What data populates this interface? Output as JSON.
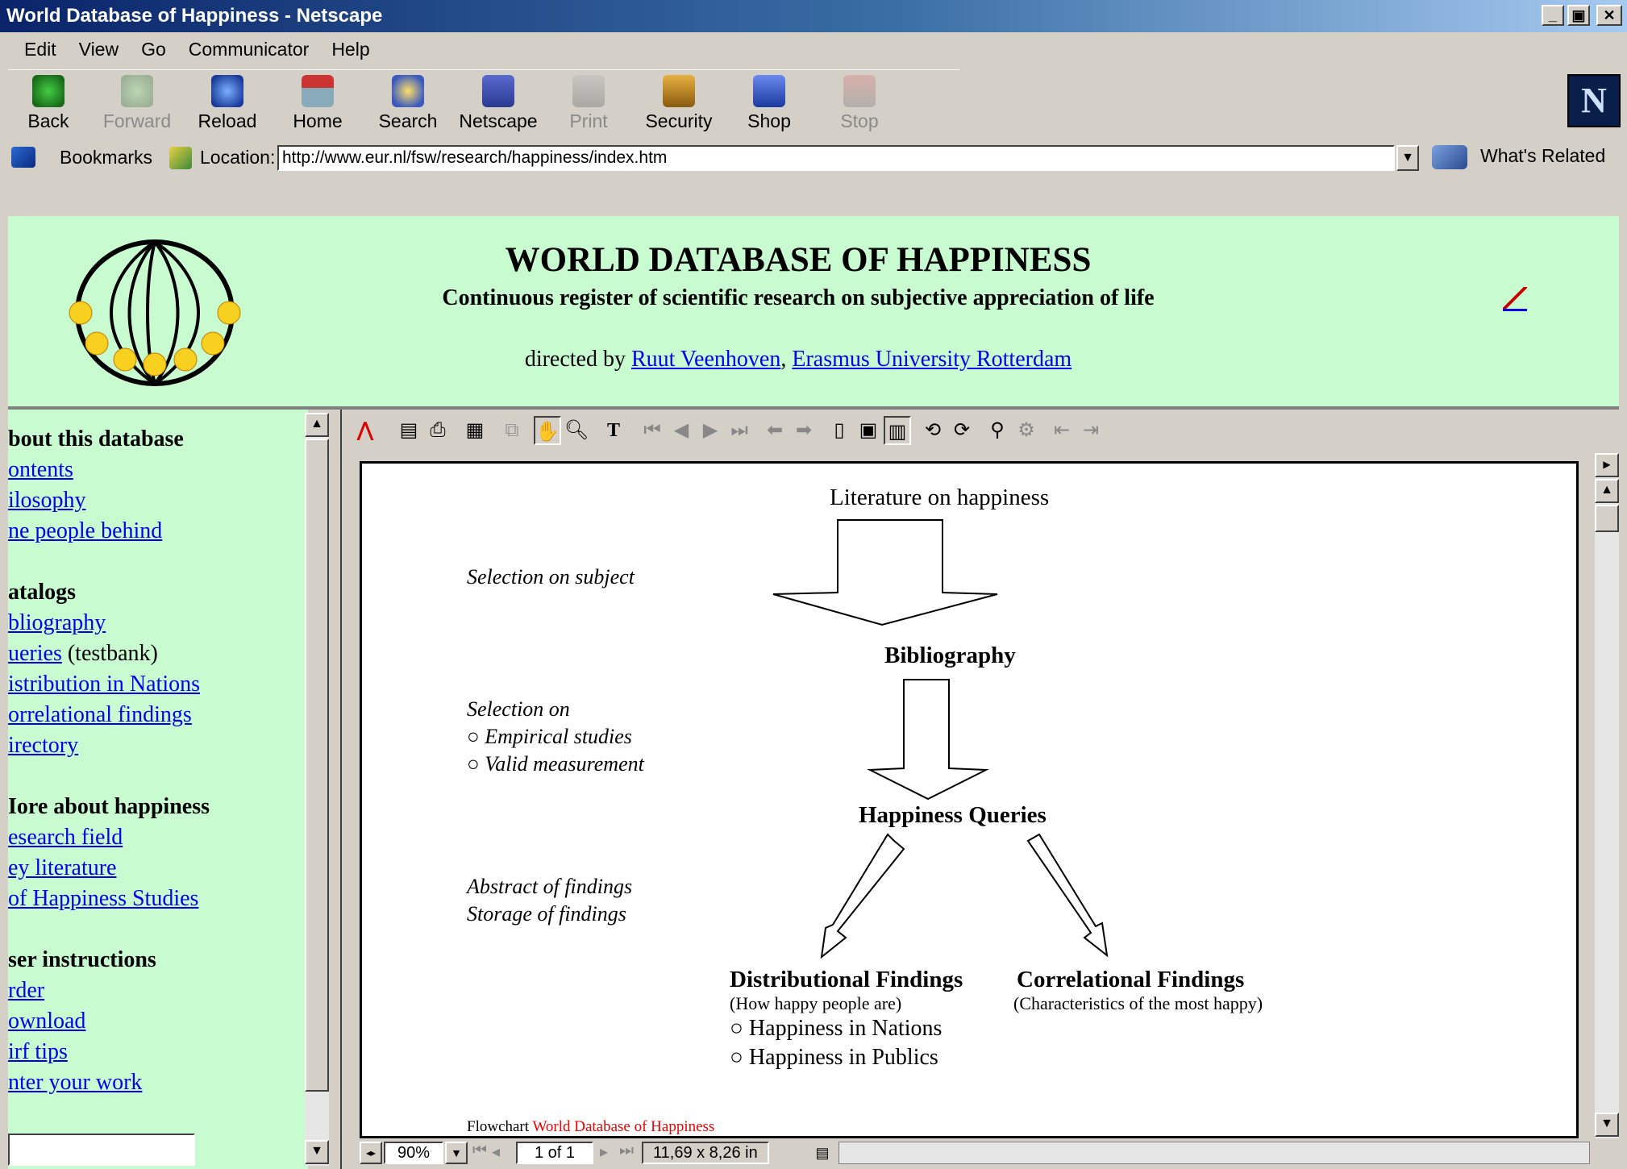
{
  "window": {
    "title": "World Database of Happiness - Netscape"
  },
  "menu": [
    "Edit",
    "View",
    "Go",
    "Communicator",
    "Help"
  ],
  "toolbar": {
    "buttons": [
      {
        "label": "Back",
        "icon": "back-arrow-icon",
        "enabled": true
      },
      {
        "label": "Forward",
        "icon": "forward-arrow-icon",
        "enabled": false
      },
      {
        "label": "Reload",
        "icon": "reload-icon",
        "enabled": true
      },
      {
        "label": "Home",
        "icon": "home-icon",
        "enabled": true
      },
      {
        "label": "Search",
        "icon": "search-icon",
        "enabled": true
      },
      {
        "label": "Netscape",
        "icon": "my-netscape-icon",
        "enabled": true
      },
      {
        "label": "Print",
        "icon": "print-icon",
        "enabled": false
      },
      {
        "label": "Security",
        "icon": "security-lock-icon",
        "enabled": true
      },
      {
        "label": "Shop",
        "icon": "shop-bag-icon",
        "enabled": true
      },
      {
        "label": "Stop",
        "icon": "stop-icon",
        "enabled": false
      }
    ],
    "logo": "N"
  },
  "location": {
    "bookmarks_label": "Bookmarks",
    "location_label": "Location:",
    "url": "http://www.eur.nl/fsw/research/happiness/index.htm",
    "whats_related": "What's Related"
  },
  "header": {
    "title": "WORLD DATABASE OF HAPPINESS",
    "subtitle": "Continuous register of scientific research on subjective appreciation of life",
    "directed_by": "directed by",
    "link_person": "Ruut Veenhoven",
    "separator": ",",
    "link_university": "Erasmus University Rotterdam"
  },
  "sidebar": {
    "sections": [
      {
        "heading": "bout this database",
        "items": [
          "ontents ",
          "ilosophy",
          "ne people behind"
        ]
      },
      {
        "heading": "atalogs",
        "items": [
          "bliography",
          "ueries",
          "istribution in Nations",
          "orrelational findings ",
          "irectory"
        ],
        "query_suffix": " (testbank)"
      },
      {
        "heading": "Iore about happiness",
        "items": [
          "esearch field",
          "ey literature",
          "of Happiness Studies"
        ]
      },
      {
        "heading": "ser instructions",
        "items": [
          "rder",
          "ownload",
          "irf tips",
          "nter your work"
        ]
      }
    ]
  },
  "pdf": {
    "zoom": "90%",
    "page_indicator": "1 of 1",
    "page_size": "11,69 x 8,26 in",
    "flowchart": {
      "top": "Literature on happiness",
      "sel1": "Selection on subject",
      "node1": "Bibliography",
      "sel2_title": "Selection on",
      "sel2_items": [
        "Empirical studies",
        "Valid measurement"
      ],
      "node2": "Happiness Queries",
      "sel3": [
        "Abstract of findings",
        "Storage of findings"
      ],
      "dist_title": "Distributional Findings",
      "dist_sub": "(How happy people are)",
      "dist_items": [
        "Happiness in Nations",
        "Happiness in Publics"
      ],
      "corr_title": "Correlational Findings",
      "corr_sub": "(Characteristics of the most happy)",
      "caption_prefix": "Flowchart ",
      "caption_red": "World Database of Happiness"
    }
  },
  "colors": {
    "frame_bg": "#c8fcd0",
    "link": "#0000ee",
    "caption_red": "#ee0000"
  }
}
